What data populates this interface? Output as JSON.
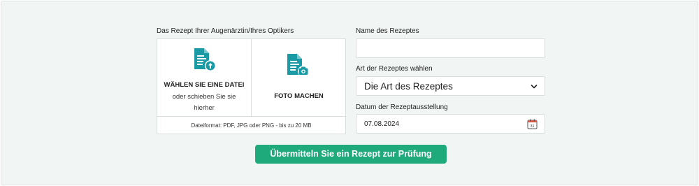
{
  "upload": {
    "section_label": "Das Rezept Ihrer Augenärztin/Ihres Optikers",
    "choose_title": "WÄHLEN SIE EINE DATEI",
    "choose_sub": "oder schieben Sie sie hierher",
    "photo_title": "FOTO MACHEN",
    "formats": "Dateiformat: PDF, JPG oder PNG - bis zu 20 MB",
    "icon_color": "#1a9aa5"
  },
  "form": {
    "name_label": "Name des Rezeptes",
    "name_value": "",
    "type_label": "Art der Rezeptes wählen",
    "type_selected": "Die Art des Rezeptes",
    "date_label": "Datum der Rezeptausstellung",
    "date_value": "07.08.2024",
    "calendar_day": "31"
  },
  "submit_label": "Übermitteln Sie ein Rezept zur Prüfung",
  "colors": {
    "accent": "#1faa7c",
    "background": "#f1f6f5"
  }
}
